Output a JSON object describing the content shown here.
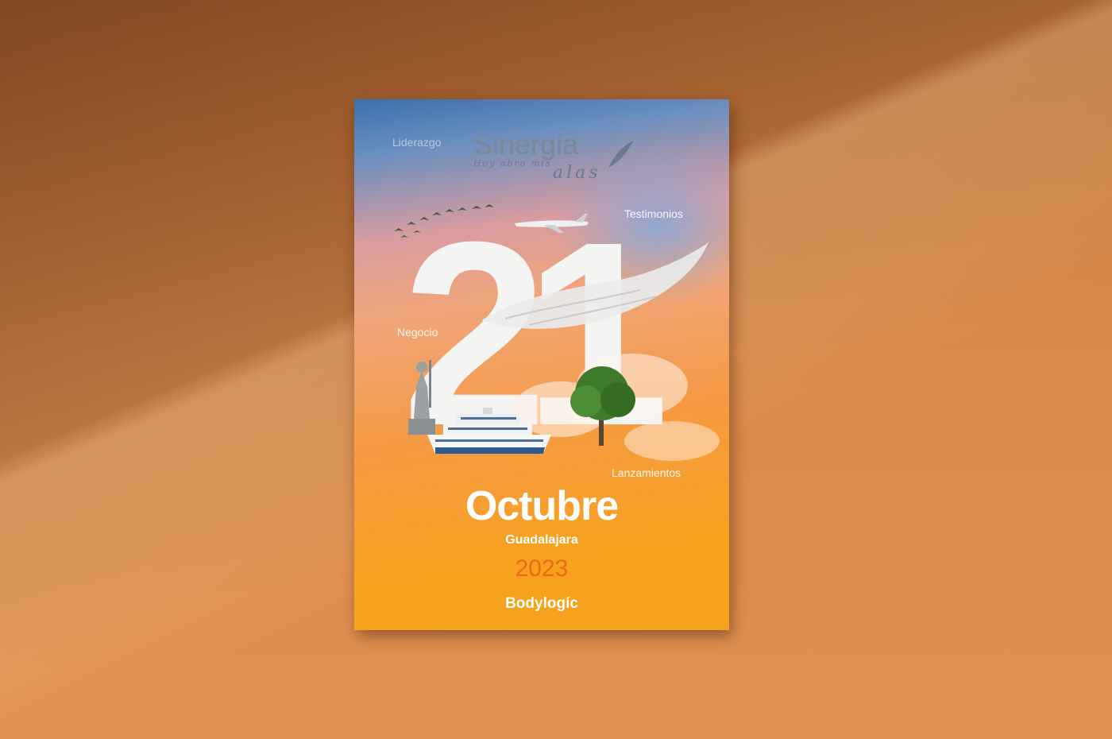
{
  "poster": {
    "title": "Sinergia",
    "tagline_small": "Hoy abro mis",
    "tagline_large": "alas",
    "number": "21",
    "month": "Octubre",
    "city": "Guadalajara",
    "year": "2023",
    "logo": "Bodylogíc",
    "words": {
      "liderazgo": "Liderazgo",
      "testimonios": "Testimonios",
      "negocio": "Negocio",
      "lanzamientos": "Lanzamientos"
    }
  },
  "colors": {
    "wall": "#d9894a",
    "year": "#e86a1a",
    "title": "#7b8697",
    "number": "#f4f4f2"
  },
  "icons": [
    "bird-flock-icon",
    "airplane-icon",
    "angel-wing-icon",
    "statue-icon",
    "cruise-ship-icon",
    "tree-icon",
    "cloud-icon",
    "leaf-icon"
  ]
}
